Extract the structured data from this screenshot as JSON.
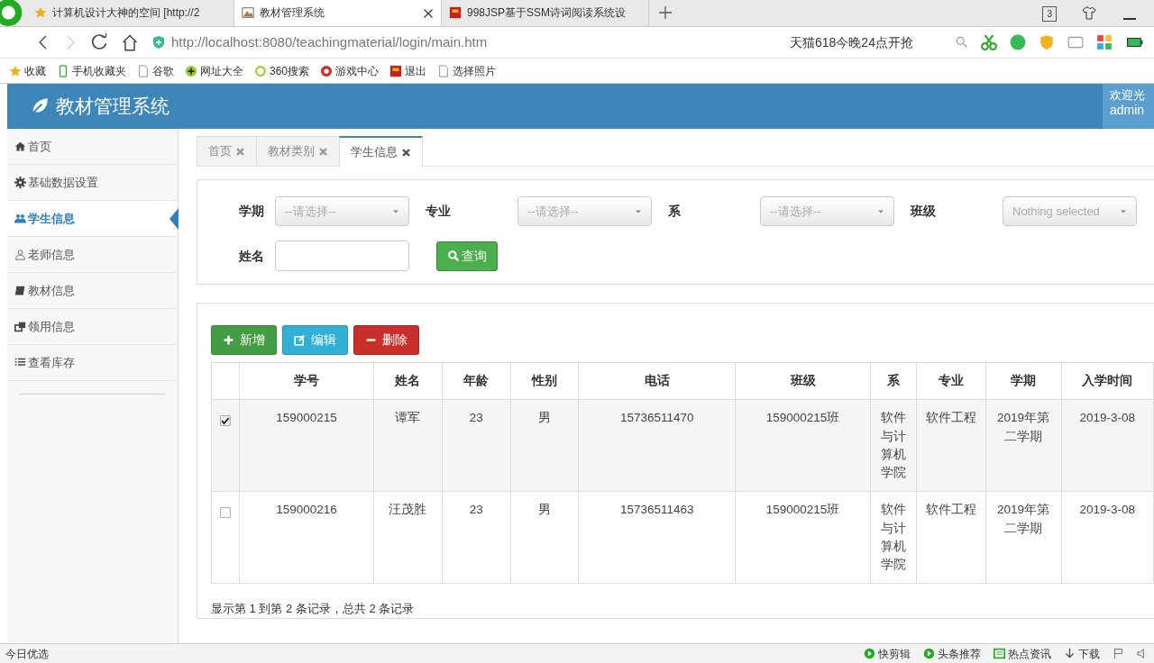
{
  "browser": {
    "tabs": [
      {
        "title": "计算机设计大神的空间 [http://2",
        "selected": false
      },
      {
        "title": "教材管理系统",
        "selected": true
      },
      {
        "title": "998JSP基于SSM诗词阅读系统设",
        "selected": false
      }
    ],
    "tab_count": "3",
    "address": "http://localhost:8080/teachingmaterial/login/main.htm",
    "search_hint": "天猫618今晚24点开抢",
    "bookmarks": [
      "收藏",
      "手机收藏夹",
      "谷歌",
      "网址大全",
      "360搜索",
      "游戏中心",
      "退出",
      "选择照片"
    ]
  },
  "app": {
    "title": "教材管理系统",
    "welcome": "欢迎光",
    "user": "admin",
    "sidebar": {
      "items": [
        {
          "label": "首页",
          "selected": false
        },
        {
          "label": "基础数据设置",
          "selected": false
        },
        {
          "label": "学生信息",
          "selected": true
        },
        {
          "label": "老师信息",
          "selected": false
        },
        {
          "label": "教材信息",
          "selected": false
        },
        {
          "label": "领用信息",
          "selected": false
        },
        {
          "label": "查看库存",
          "selected": false
        }
      ]
    },
    "tabs": [
      {
        "label": "首页",
        "selected": false
      },
      {
        "label": "教材类别",
        "selected": false
      },
      {
        "label": "学生信息",
        "selected": true
      }
    ],
    "filters": [
      {
        "label": "学期",
        "kind": "select",
        "value": "--请选择--"
      },
      {
        "label": "专业",
        "kind": "select",
        "value": "--请选择--"
      },
      {
        "label": "系",
        "kind": "select",
        "value": "--请选择--"
      },
      {
        "label": "班级",
        "kind": "select",
        "value": "Nothing selected"
      },
      {
        "label": "姓名",
        "kind": "input"
      }
    ],
    "search_button": "查询",
    "actions": [
      {
        "label": "新增",
        "kind": "add"
      },
      {
        "label": "编辑",
        "kind": "edit"
      },
      {
        "label": "删除",
        "kind": "delete"
      }
    ],
    "table": {
      "columns": [
        "学号",
        "姓名",
        "年龄",
        "性别",
        "电话",
        "班级",
        "系",
        "专业",
        "学期",
        "入学时间"
      ],
      "rows": [
        {
          "checked": true,
          "cells": [
            "159000215",
            "谭军",
            "23",
            "男",
            "15736511470",
            "159000215班",
            "软件与计算机学院",
            "软件工程",
            "2019年第二学期",
            "2019-3-08"
          ]
        },
        {
          "checked": false,
          "cells": [
            "159000216",
            "汪茂胜",
            "23",
            "男",
            "15736511463",
            "159000215班",
            "软件与计算机学院",
            "软件工程",
            "2019年第二学期",
            "2019-3-08"
          ]
        }
      ]
    },
    "footer": "显示第 1 到第 2 条记录，总共 2 条记录"
  },
  "status_bar": {
    "left": "今日优选",
    "items": [
      "快剪辑",
      "头条推荐",
      "热点资讯",
      "下载"
    ]
  }
}
